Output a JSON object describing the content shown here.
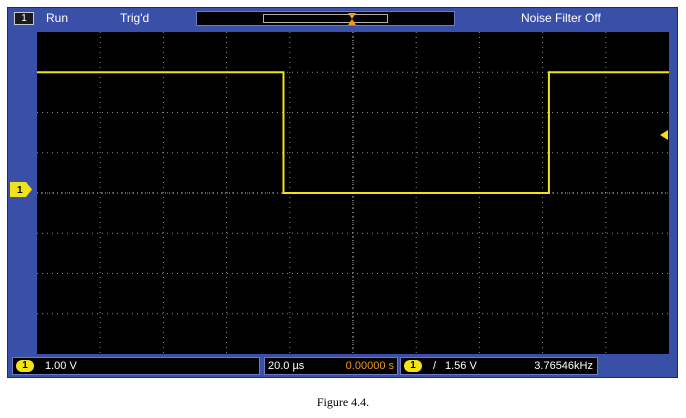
{
  "top_bar": {
    "channel_icon": "1",
    "run_status": "Run",
    "trigger_status": "Trig'd",
    "noise_filter": "Noise Filter Off"
  },
  "screen": {
    "ground_marker": "1",
    "signal": {
      "type": "square-wave",
      "color": "#f2e316",
      "high_level_div": 3.0,
      "low_level_div": 0.0,
      "edges_div": [
        0.0,
        3.9,
        8.1,
        12.2,
        16.4
      ]
    }
  },
  "bottom_bar": {
    "ch1_badge": "1",
    "volts_per_div": "1.00 V",
    "time_per_div": "20.0 µs",
    "time_offset": "0.00000 s",
    "trigger_badge": "1",
    "trigger_slope": "/",
    "trigger_level": "1.56 V",
    "frequency": "3.76546kHz"
  },
  "caption": "Figure 4.4.",
  "colors": {
    "frame": "#3a4fa8",
    "screen": "#000000",
    "channel1": "#f2e316",
    "trigger_marker": "#f29a14"
  }
}
